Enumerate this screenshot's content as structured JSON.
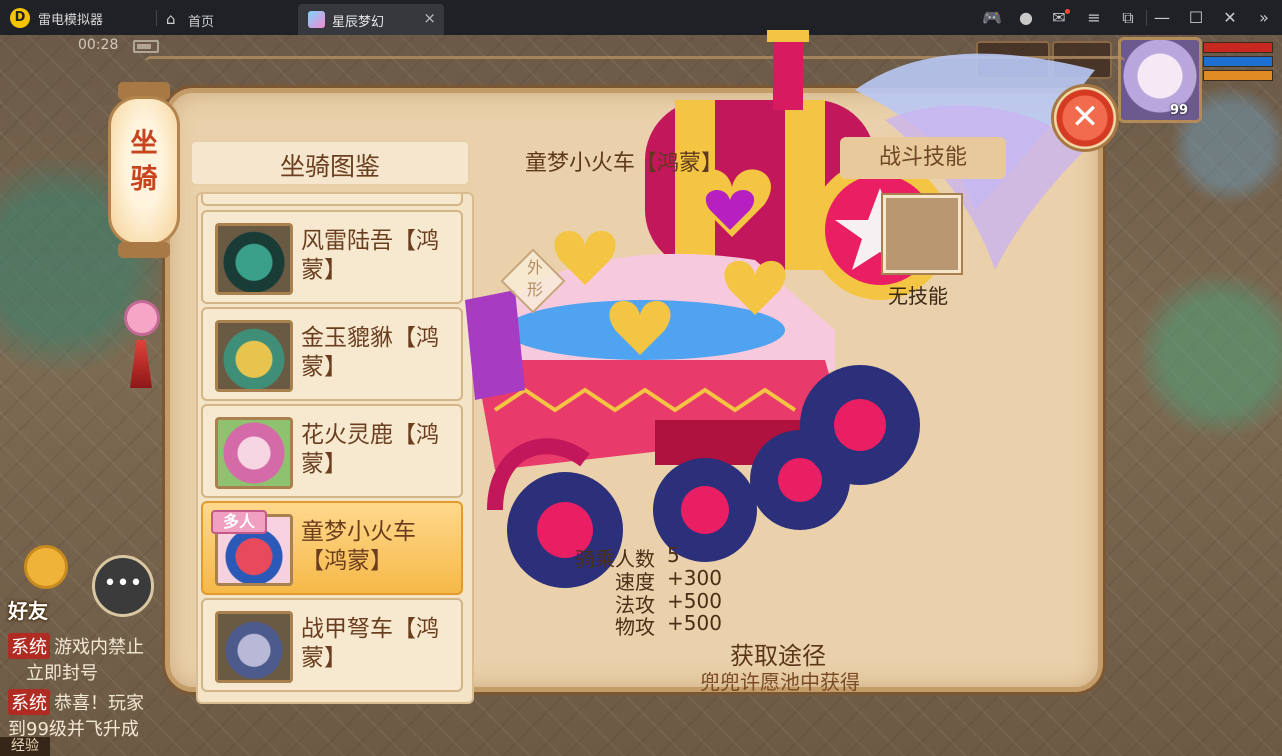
{
  "window": {
    "app_title": "雷电模拟器",
    "home_tab": "首页",
    "game_tab": "星辰梦幻",
    "close_tab_glyph": "×",
    "toolbar_icons": [
      "gamepad-icon",
      "user-icon",
      "mail-icon",
      "menu-icon",
      "window-restore-icon",
      "minimize-icon",
      "maximize-icon",
      "close-icon",
      "collapse-sidebar-icon"
    ]
  },
  "status": {
    "time": "00:28"
  },
  "hud": {
    "level": "99"
  },
  "chat": {
    "friend_label": "好友",
    "lines": [
      {
        "tag": "系统",
        "text": "游戏内禁止"
      },
      {
        "tag": "",
        "text": "立即封号"
      },
      {
        "tag": "系统",
        "text": "恭喜！玩家"
      },
      {
        "tag": "",
        "text": "到99级并飞升成"
      }
    ],
    "exp_label": "经验"
  },
  "mount_panel": {
    "category_title": "坐骑",
    "list_title": "坐骑图鉴",
    "items": [
      {
        "name": "风雷陆吾【鸿蒙】",
        "tag": ""
      },
      {
        "name": "金玉貔貅【鸿蒙】",
        "tag": ""
      },
      {
        "name": "花火灵鹿【鸿蒙】",
        "tag": ""
      },
      {
        "name": "童梦小火车【鸿蒙】",
        "tag": "多人"
      },
      {
        "name": "战甲弩车【鸿蒙】",
        "tag": ""
      }
    ],
    "selected": {
      "name": "童梦小火车【鸿蒙】",
      "appearance_label": "外形",
      "skill_header": "战斗技能",
      "no_skill": "无技能",
      "stats": [
        {
          "label": "骑乘人数",
          "value": "5"
        },
        {
          "label": "速度",
          "value": "+300"
        },
        {
          "label": "法攻",
          "value": "+500"
        },
        {
          "label": "物攻",
          "value": "+500"
        }
      ],
      "obtain_title": "获取途径",
      "obtain_text": "兜兜许愿池中获得"
    }
  },
  "colors": {
    "panel_bg": "#ead1ab",
    "panel_border": "#c49c68",
    "selected_item": "#f6b848",
    "text_brown": "#6a3e1f",
    "close_red": "#d53a22"
  }
}
